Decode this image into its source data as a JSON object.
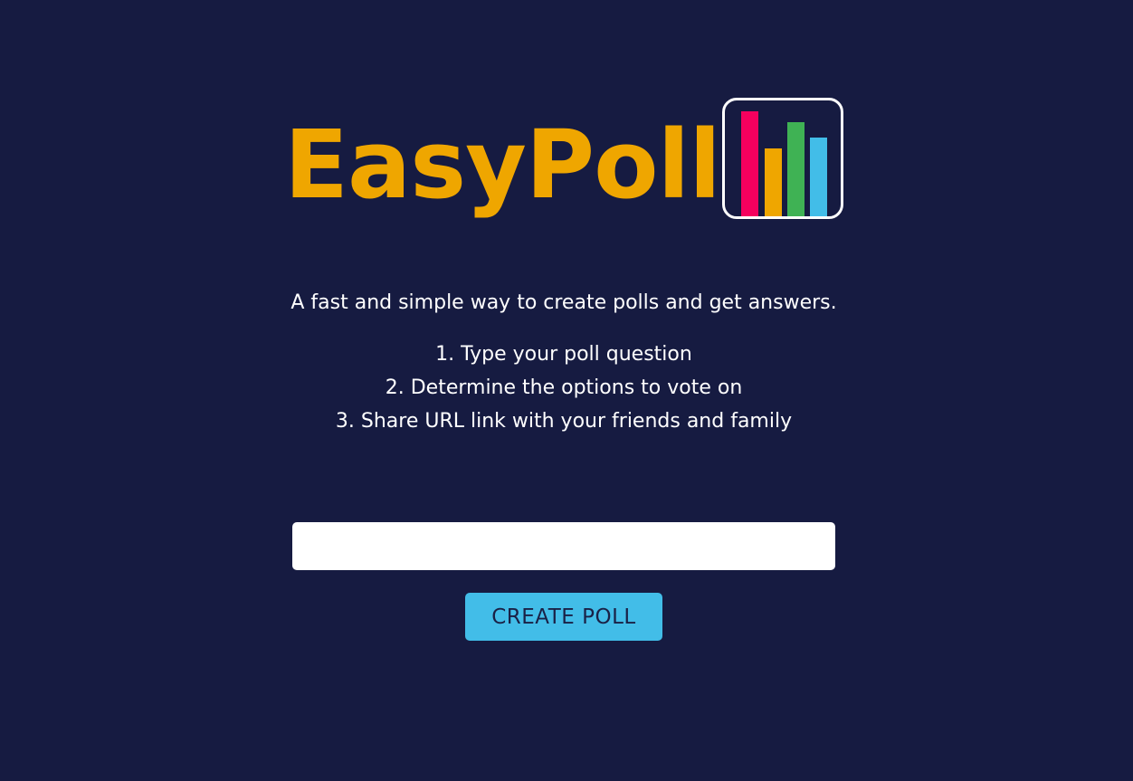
{
  "brand": {
    "name": "EasyPoll",
    "logo_icon": "bar-chart-icon",
    "name_color": "#efa600",
    "bar_colors": [
      "#f5005e",
      "#efa600",
      "#3fb254",
      "#42bde8"
    ]
  },
  "intro": {
    "tagline": "A fast and simple way to create polls and get answers.",
    "steps": [
      "1. Type your poll question",
      "2. Determine the options to vote on",
      "3. Share URL link with your friends and family"
    ]
  },
  "form": {
    "question_value": "",
    "question_placeholder": "",
    "submit_label": "CREATE POLL",
    "submit_color": "#42bde8"
  },
  "background_color": "#161b41"
}
